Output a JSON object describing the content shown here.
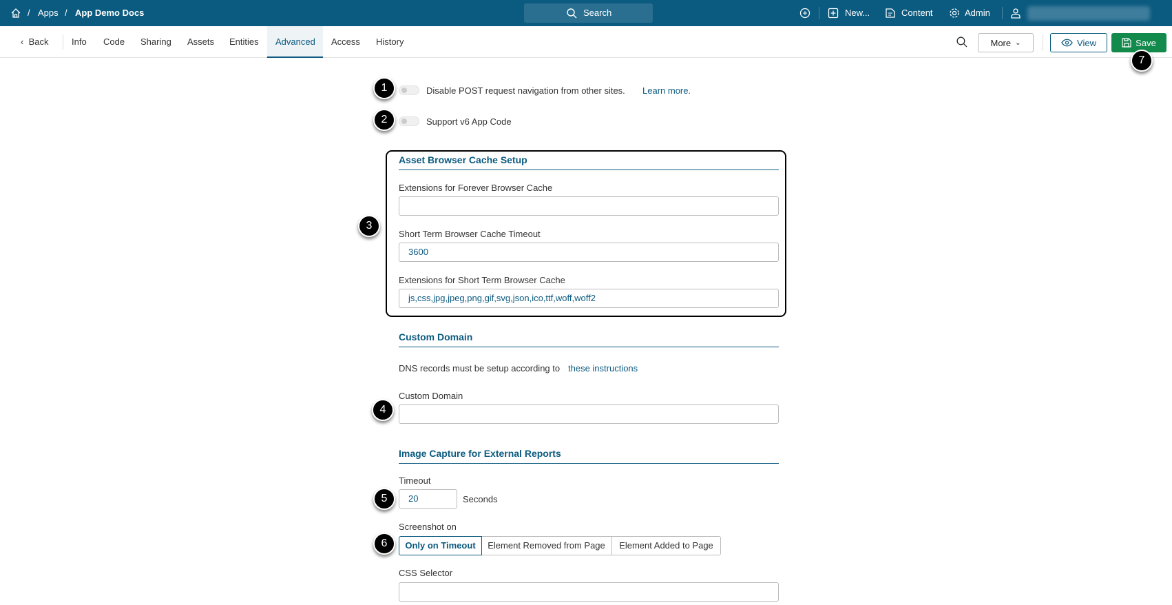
{
  "topbar": {
    "breadcrumb": [
      "Apps",
      "App Demo Docs"
    ],
    "search_label": "Search",
    "new_label": "New...",
    "content_label": "Content",
    "admin_label": "Admin"
  },
  "tabs": {
    "back": "Back",
    "items": [
      "Info",
      "Code",
      "Sharing",
      "Assets",
      "Entities",
      "Advanced",
      "Access",
      "History"
    ],
    "active": "Advanced"
  },
  "toolbar": {
    "more": "More",
    "view": "View",
    "save": "Save"
  },
  "settings": {
    "disable_post": "Disable POST request navigation from other sites.",
    "learn_more": "Learn more.",
    "support_v6": "Support v6 App Code"
  },
  "cache": {
    "heading": "Asset Browser Cache Setup",
    "forever_label": "Extensions for Forever Browser Cache",
    "forever_value": "",
    "timeout_label": "Short Term Browser Cache Timeout",
    "timeout_value": "3600",
    "short_label": "Extensions for Short Term Browser Cache",
    "short_value": "js,css,jpg,jpeg,png,gif,svg,json,ico,ttf,woff,woff2"
  },
  "domain": {
    "heading": "Custom Domain",
    "dns_text": "DNS records must be setup according to",
    "dns_link": "these instructions",
    "label": "Custom Domain",
    "value": ""
  },
  "capture": {
    "heading": "Image Capture for External Reports",
    "timeout_label": "Timeout",
    "timeout_value": "20",
    "seconds": "Seconds",
    "screenshot_label": "Screenshot on",
    "options": [
      "Only on Timeout",
      "Element Removed from Page",
      "Element Added to Page"
    ],
    "selected": "Only on Timeout",
    "css_label": "CSS Selector",
    "css_value": ""
  },
  "callouts": [
    "1",
    "2",
    "3",
    "4",
    "5",
    "6",
    "7"
  ],
  "colors": {
    "brand": "#0b5a7f",
    "save": "#118a4b"
  }
}
